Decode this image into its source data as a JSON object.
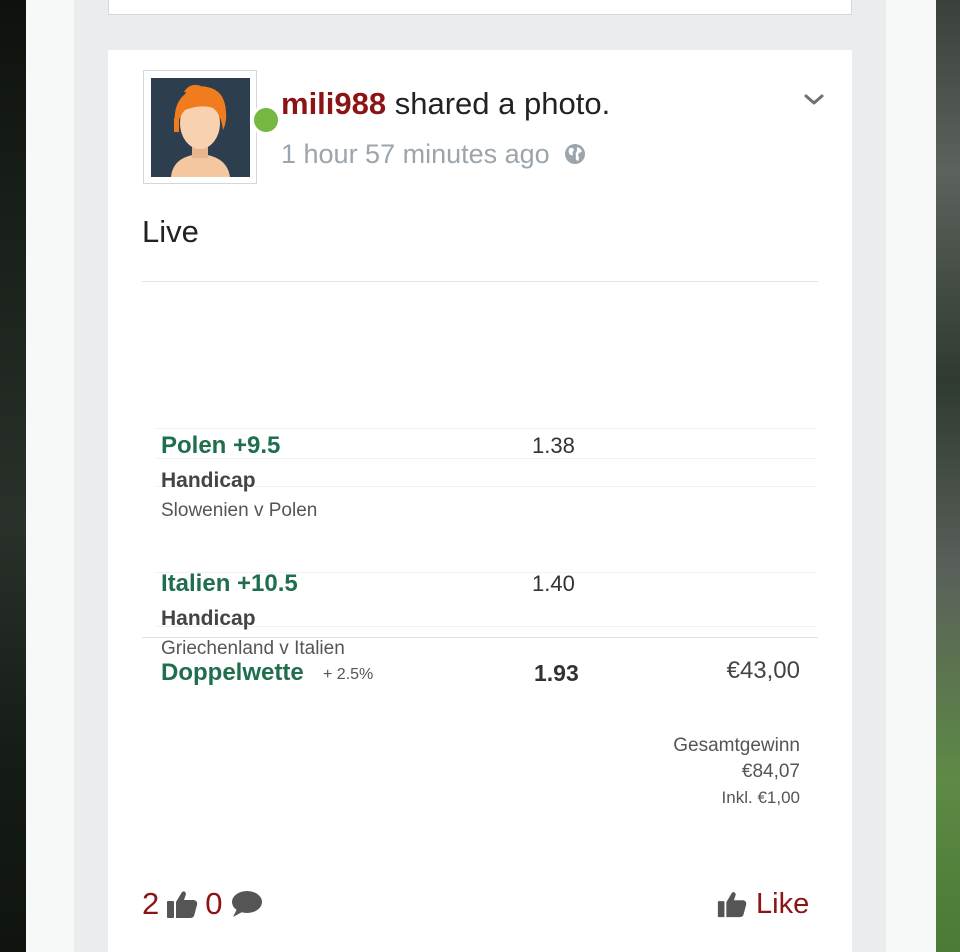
{
  "post": {
    "author": "mili988",
    "action": " shared a photo.",
    "time": "1 hour 57 minutes ago",
    "privacy_icon": "globe-icon",
    "text": "Live"
  },
  "bet_slip": {
    "selections": [
      {
        "name": "Polen +9.5",
        "market": "Handicap",
        "event": "Slowenien v Polen",
        "odds": "1.38"
      },
      {
        "name": "Italien +10.5",
        "market": "Handicap",
        "event": "Griechenland v Italien",
        "odds": "1.40"
      }
    ],
    "combo": {
      "name": "Doppelwette",
      "boost": "+ 2.5%",
      "odds": "1.93",
      "stake": "€43,00"
    },
    "return_label": "Gesamtgewinn",
    "return_value": "€84,07",
    "included": "Inkl. €1,00"
  },
  "reactions": {
    "likes": "2",
    "comments": "0"
  },
  "actions": {
    "like_label": "Like"
  },
  "colors": {
    "accent": "#8c1414",
    "bet_green": "#1f6e4d",
    "online": "#74b842",
    "avatar_bg": "#2d3e4f"
  }
}
